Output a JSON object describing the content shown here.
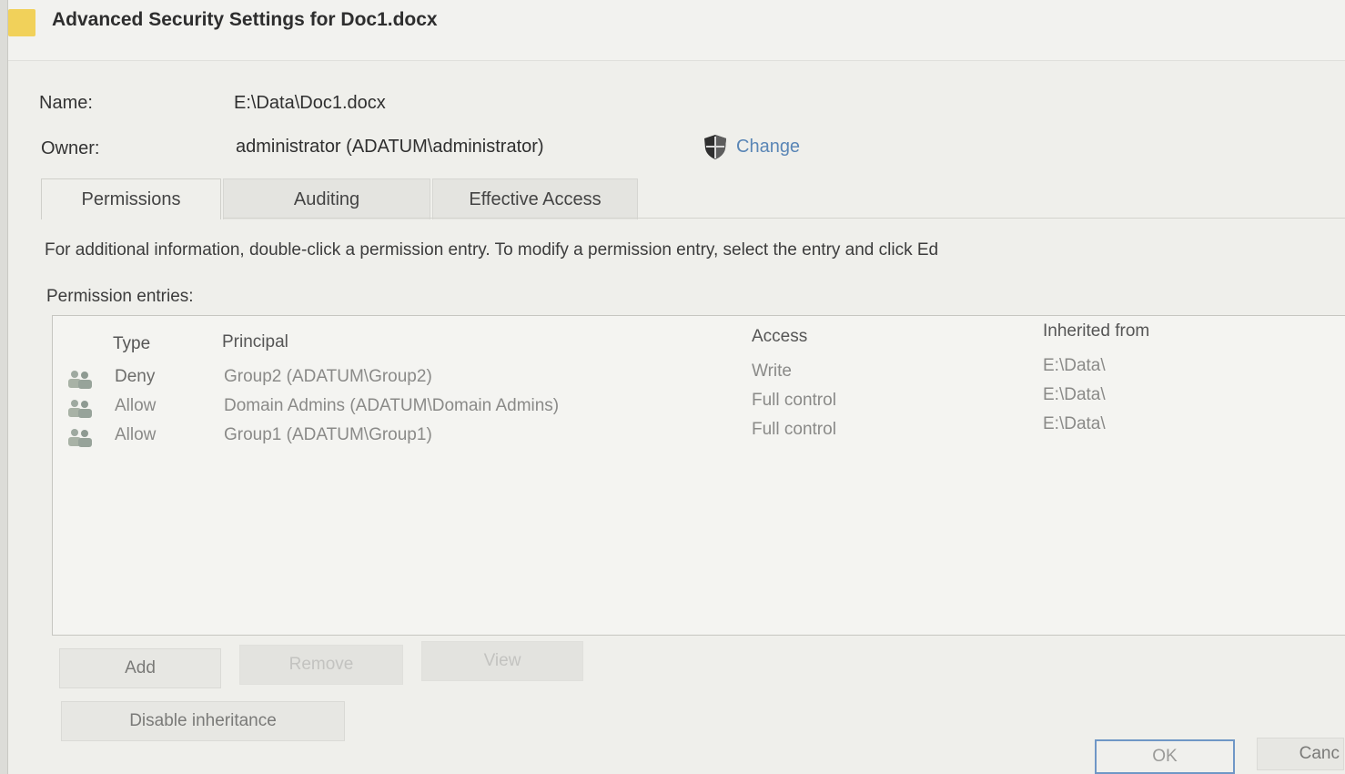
{
  "window": {
    "title": "Advanced Security Settings for Doc1.docx",
    "title_icon": "folder-icon"
  },
  "fields": {
    "name_label": "Name:",
    "name_value": "E:\\Data\\Doc1.docx",
    "owner_label": "Owner:",
    "owner_value": "administrator (ADATUM\\administrator)",
    "change_label": "Change",
    "change_icon": "shield-icon"
  },
  "tabs": [
    {
      "label": "Permissions",
      "active": true
    },
    {
      "label": "Auditing",
      "active": false
    },
    {
      "label": "Effective Access",
      "active": false
    }
  ],
  "info_text": "For additional information, double-click a permission entry. To modify a permission entry, select the entry and click Ed",
  "entries_label": "Permission entries:",
  "table": {
    "columns": [
      "Type",
      "Principal",
      "Access",
      "Inherited from"
    ],
    "rows": [
      {
        "type": "Deny",
        "principal": "Group2 (ADATUM\\Group2)",
        "access": "Write",
        "inherited": "E:\\Data\\"
      },
      {
        "type": "Allow",
        "principal": "Domain Admins (ADATUM\\Domain Admins)",
        "access": "Full control",
        "inherited": "E:\\Data\\"
      },
      {
        "type": "Allow",
        "principal": "Group1 (ADATUM\\Group1)",
        "access": "Full control",
        "inherited": "E:\\Data\\"
      }
    ]
  },
  "buttons": {
    "add": "Add",
    "remove": "Remove",
    "view": "View",
    "disable_inheritance": "Disable inheritance",
    "ok": "OK",
    "cancel": "Canc"
  },
  "colors": {
    "link": "#5a86b6",
    "ok_border": "#6f97c6",
    "folder": "#f1d15a"
  }
}
